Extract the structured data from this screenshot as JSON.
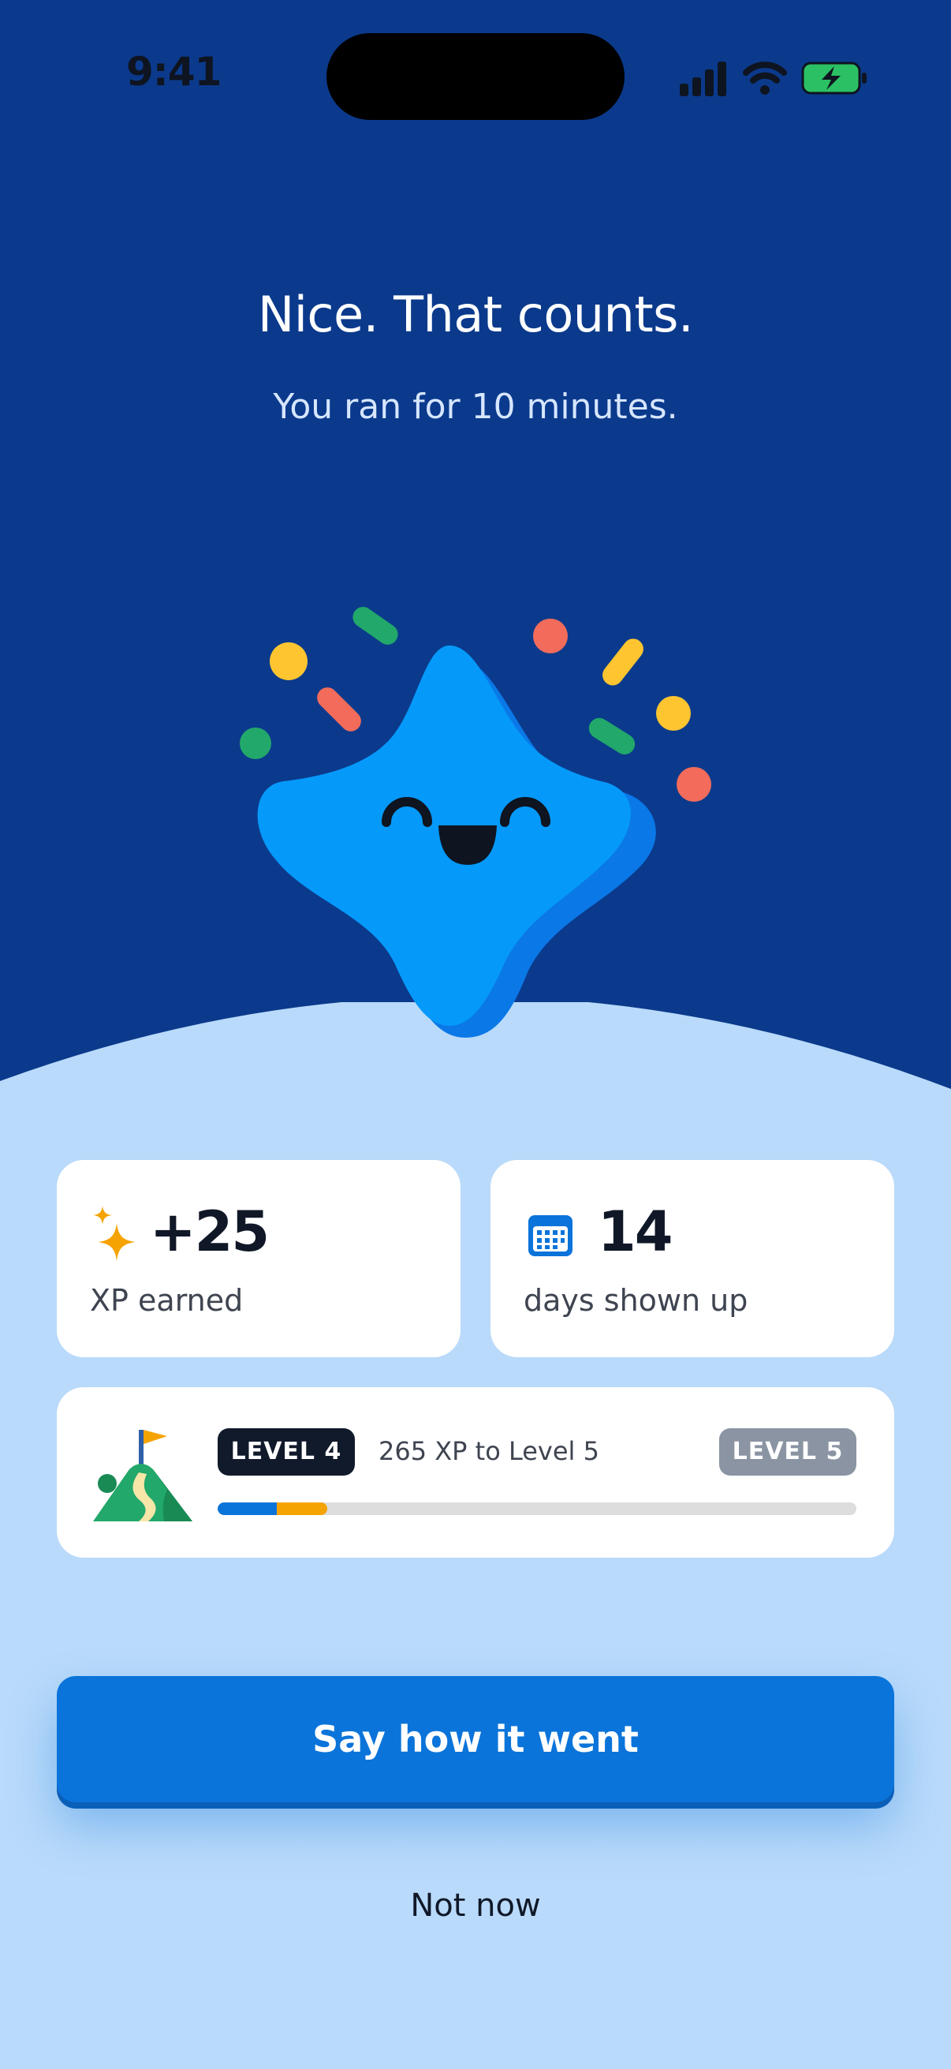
{
  "status_bar": {
    "time": "9:41",
    "icons": [
      "cellular-signal-icon",
      "wifi-icon",
      "battery-charging-icon"
    ]
  },
  "header": {
    "title": "Nice. That counts.",
    "subtitle": "You ran for 10 minutes."
  },
  "mascot": {
    "name": "happy-star-mascot-illustration"
  },
  "stats": {
    "xp": {
      "icon": "sparkle-icon",
      "value": "+25",
      "label": "XP earned"
    },
    "days": {
      "icon": "calendar-icon",
      "value": "14",
      "label": "days shown up"
    }
  },
  "level": {
    "icon": "mountain-flag-icon",
    "current_label": "LEVEL 4",
    "progress_text": "265 XP to Level 5",
    "next_label": "LEVEL 5",
    "progress_fraction_blue": 0.093,
    "progress_fraction_total": 0.172
  },
  "actions": {
    "primary_label": "Say how it went",
    "secondary_label": "Not now"
  },
  "colors": {
    "background_top": "#0B3A8C",
    "background_bottom": "#B9DAFA",
    "accent_blue": "#0B74DA",
    "xp_orange": "#F5A300"
  }
}
